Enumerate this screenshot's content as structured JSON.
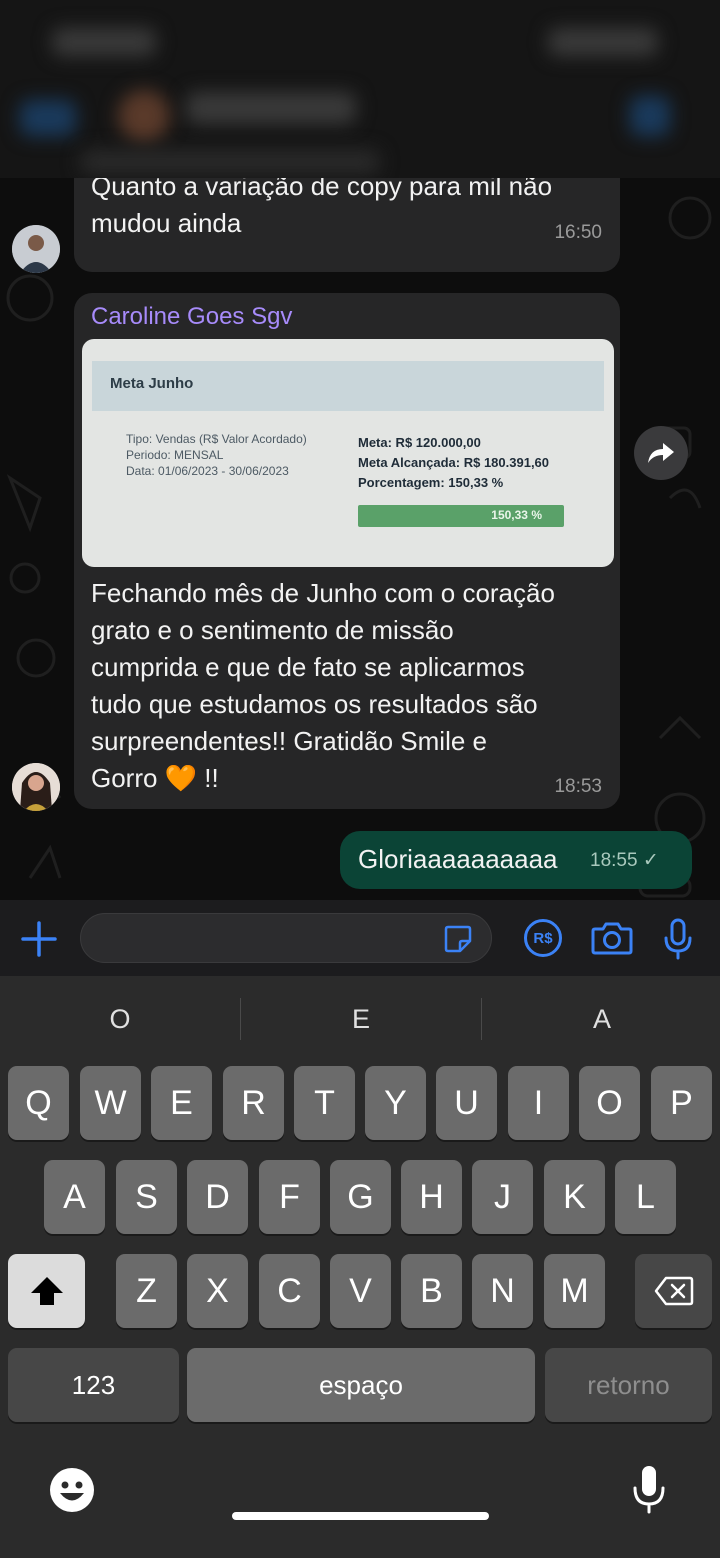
{
  "chat": {
    "messages": [
      {
        "text_line1": "Quanto a variação de copy para mil não",
        "text_line2": "mudou ainda",
        "time": "16:50"
      },
      {
        "sender": "Caroline Goes Sgv",
        "image": {
          "title": "Meta Junho",
          "tipo": "Tipo: Vendas (R$ Valor Acordado)",
          "periodo": "Periodo: MENSAL",
          "data": "Data: 01/06/2023 - 30/06/2023",
          "meta": "Meta: R$ 120.000,00",
          "meta_alcancada": "Meta Alcançada: R$ 180.391,60",
          "porcentagem": "Porcentagem: 150,33 %",
          "bar_label": "150,33 %"
        },
        "lines": [
          "Fechando mês de Junho com o coração",
          "grato e o sentimento de missão",
          "cumprida e que de fato se aplicarmos",
          "tudo que estudamos os resultados são",
          "surpreendentes!! Gratidão Smile e",
          "Gorro 🧡 !!"
        ],
        "time": "18:53"
      },
      {
        "text": "Gloriaaaaaaaaaa",
        "time": "18:55",
        "status": "✓"
      }
    ]
  },
  "input": {
    "placeholder": "",
    "icons": [
      "plus-icon",
      "sticker-icon",
      "pix-icon",
      "camera-icon",
      "microphone-icon"
    ],
    "pix_label": "R$"
  },
  "keyboard": {
    "suggestions": [
      "O",
      "E",
      "A"
    ],
    "row1": [
      "Q",
      "W",
      "E",
      "R",
      "T",
      "Y",
      "U",
      "I",
      "O",
      "P"
    ],
    "row2": [
      "A",
      "S",
      "D",
      "F",
      "G",
      "H",
      "J",
      "K",
      "L"
    ],
    "row3": [
      "Z",
      "X",
      "C",
      "V",
      "B",
      "N",
      "M"
    ],
    "numbers_label": "123",
    "space_label": "espaço",
    "return_label": "retorno"
  },
  "colors": {
    "incoming_bubble": "#262627",
    "outgoing_bubble": "#0b4436",
    "sender_name": "#a78bfa",
    "accent_blue": "#3b82f6"
  }
}
